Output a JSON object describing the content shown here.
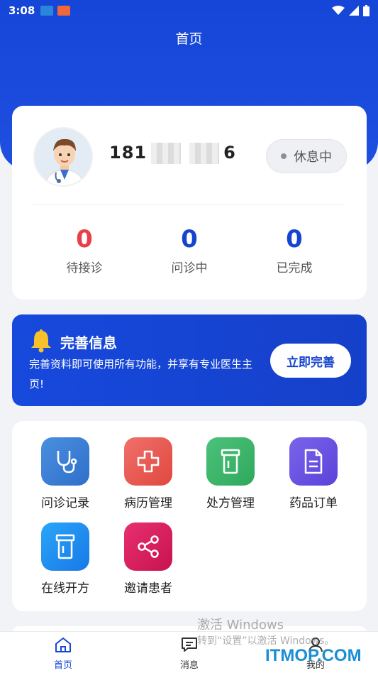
{
  "status_bar": {
    "time": "3:08"
  },
  "header": {
    "title": "首页"
  },
  "profile": {
    "phone_prefix": "181",
    "phone_suffix": "6",
    "status_label": "休息中"
  },
  "stats": [
    {
      "value": "0",
      "label": "待接诊",
      "color": "#e8404b"
    },
    {
      "value": "0",
      "label": "问诊中",
      "color": "#1545d0"
    },
    {
      "value": "0",
      "label": "已完成",
      "color": "#1545d0"
    }
  ],
  "banner": {
    "title": "完善信息",
    "text": "完善资料即可使用所有功能，并享有专业医生主页!",
    "button": "立即完善"
  },
  "menu": [
    {
      "label": "问诊记录",
      "icon": "stethoscope-icon",
      "color": "#3a7fd4"
    },
    {
      "label": "病历管理",
      "icon": "medical-cross-icon",
      "color": "#e85a55"
    },
    {
      "label": "处方管理",
      "icon": "medicine-bottle-icon",
      "color": "#3bb268"
    },
    {
      "label": "药品订单",
      "icon": "document-icon",
      "color": "#6a54e0"
    },
    {
      "label": "在线开方",
      "icon": "pill-bottle-icon",
      "color": "#1e8ef0"
    },
    {
      "label": "邀请患者",
      "icon": "share-icon",
      "color": "#d91c5c"
    }
  ],
  "tabs": [
    {
      "label": "首页",
      "icon": "home-icon",
      "active": true
    },
    {
      "label": "消息",
      "icon": "message-icon",
      "active": false
    },
    {
      "label": "我的",
      "icon": "user-icon",
      "active": false
    }
  ],
  "watermark": {
    "line1": "激活 Windows",
    "line2": "转到“设置”以激活 Windows。",
    "site": "ITMOP.COM"
  },
  "colors": {
    "primary": "#1646d8",
    "accent_red": "#e8404b"
  }
}
